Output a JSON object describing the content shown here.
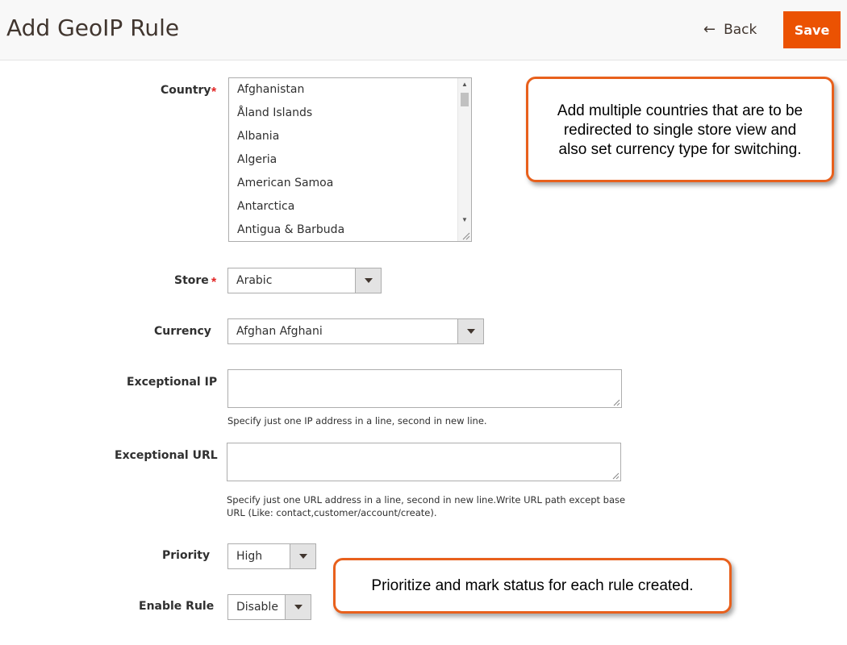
{
  "header": {
    "title": "Add GeoIP Rule",
    "back_label": "Back",
    "save_label": "Save"
  },
  "form": {
    "country": {
      "label": "Country",
      "options": [
        "Afghanistan",
        "Åland Islands",
        "Albania",
        "Algeria",
        "American Samoa",
        "Antarctica",
        "Antigua & Barbuda"
      ]
    },
    "store": {
      "label": "Store",
      "value": "Arabic"
    },
    "currency": {
      "label": "Currency",
      "value": "Afghan Afghani"
    },
    "exceptional_ip": {
      "label": "Exceptional IP",
      "value": "",
      "note": "Specify just one IP address in a line, second in new line."
    },
    "exceptional_url": {
      "label": "Exceptional URL",
      "value": "",
      "note_line1": "Specify just one URL address in a line, second in new line.Write URL path except base",
      "note_line2": "URL (Like: contact,customer/account/create)."
    },
    "priority": {
      "label": "Priority",
      "value": "High"
    },
    "enable_rule": {
      "label": "Enable Rule",
      "value": "Disable"
    },
    "required_mark": "*"
  },
  "callouts": {
    "countries_line1": "Add multiple countries that are to be",
    "countries_line2": "redirected to single store view  and",
    "countries_line3": "also set currency type for switching.",
    "priority": "Prioritize and mark status for each rule created."
  },
  "colors": {
    "accent": "#eb5202",
    "callout_border": "#e8601c",
    "required": "#e22626"
  },
  "icons": [
    "back-arrow-icon",
    "chevron-down-icon",
    "resize-grip-icon"
  ]
}
